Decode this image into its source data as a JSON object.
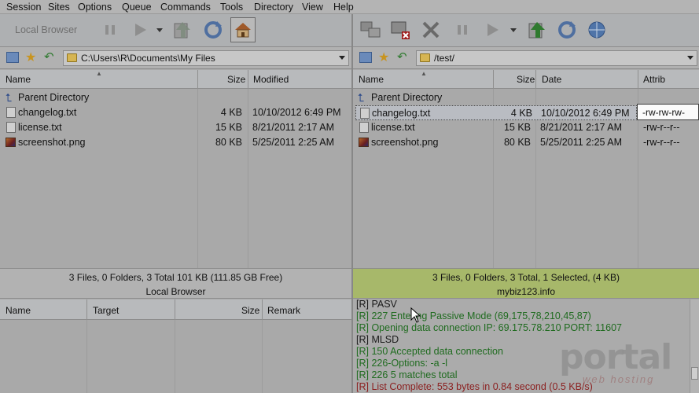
{
  "menu": [
    "Session",
    "Sites",
    "Options",
    "Queue",
    "Commands",
    "Tools",
    "Directory",
    "View",
    "Help"
  ],
  "left_toolbar": {
    "local_browser_label": "Local Browser"
  },
  "left_path": "C:\\Users\\R\\Documents\\My Files",
  "right_path": "/test/",
  "left_headers": [
    "Name",
    "Size",
    "Modified"
  ],
  "right_headers": [
    "Name",
    "Size",
    "Date",
    "Attrib"
  ],
  "left_files": [
    {
      "name": "Parent Directory",
      "size": "",
      "modified": ""
    },
    {
      "name": "changelog.txt",
      "size": "4 KB",
      "modified": "10/10/2012 6:49 PM"
    },
    {
      "name": "license.txt",
      "size": "15 KB",
      "modified": "8/21/2011 2:17 AM"
    },
    {
      "name": "screenshot.png",
      "size": "80 KB",
      "modified": "5/25/2011 2:25 AM"
    }
  ],
  "right_files": [
    {
      "name": "Parent Directory",
      "size": "",
      "date": "",
      "attrib": ""
    },
    {
      "name": "changelog.txt",
      "size": "4 KB",
      "date": "10/10/2012 6:49 PM",
      "attrib": "-rw-rw-rw-"
    },
    {
      "name": "license.txt",
      "size": "15 KB",
      "date": "8/21/2011 2:17 AM",
      "attrib": "-rw-r--r--"
    },
    {
      "name": "screenshot.png",
      "size": "80 KB",
      "date": "5/25/2011 2:25 AM",
      "attrib": "-rw-r--r--"
    }
  ],
  "left_status": {
    "summary": "3 Files, 0 Folders, 3 Total 101 KB (111.85 GB Free)",
    "label": "Local Browser"
  },
  "right_status": {
    "summary": "3 Files, 0 Folders, 3 Total, 1 Selected, (4 KB)",
    "label": "mybiz123.info"
  },
  "queue_headers": [
    "Name",
    "Target",
    "Size",
    "Remark"
  ],
  "log_lines": [
    {
      "text": "[R] PASV",
      "color": "#1a1a1a"
    },
    {
      "text": "[R] 227 Entering Passive Mode (69,175,78,210,45,87)",
      "color": "#1f6b1f"
    },
    {
      "text": "[R] Opening data connection IP: 69.175.78.210 PORT: 11607",
      "color": "#1f6b1f"
    },
    {
      "text": "[R] MLSD",
      "color": "#1a1a1a"
    },
    {
      "text": "[R] 150 Accepted data connection",
      "color": "#1f6b1f"
    },
    {
      "text": "[R] 226-Options: -a -l",
      "color": "#1f6b1f"
    },
    {
      "text": "[R] 226 5 matches total",
      "color": "#1f6b1f"
    },
    {
      "text": "[R] List Complete: 553 bytes in 0.84 second (0.5 KB/s)",
      "color": "#8b1f1f"
    }
  ],
  "watermark": {
    "brand": "portal",
    "sub": "web hosting"
  },
  "colors": {
    "remote_status_bg": "#a7b86a",
    "local_status_bg": "#b2b2b2"
  }
}
